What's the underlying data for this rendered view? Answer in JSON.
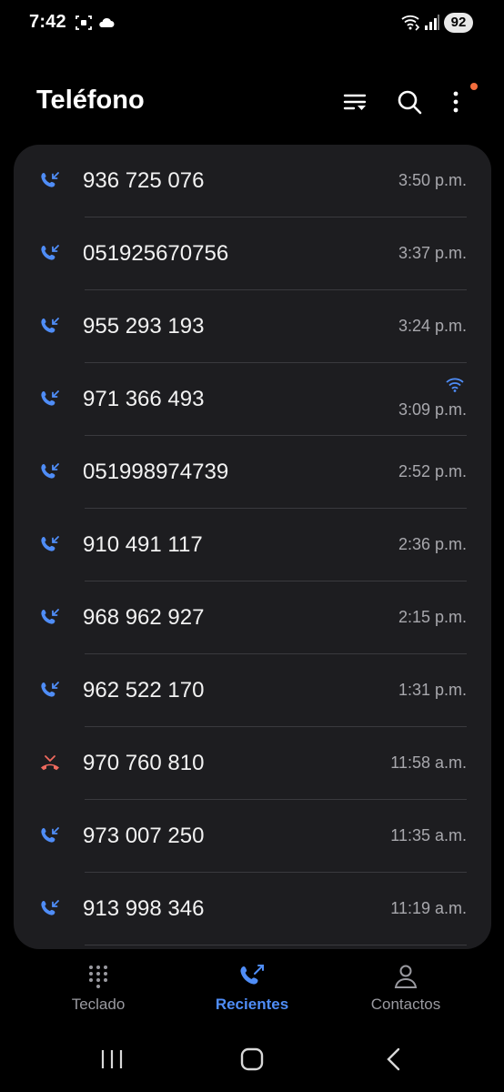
{
  "status_bar": {
    "time": "7:42",
    "battery": "92",
    "icons": [
      "screenshot-icon",
      "cloud-icon",
      "wifi-calling-icon",
      "signal-icon"
    ]
  },
  "header": {
    "title": "Teléfono",
    "icons": [
      "filter-icon",
      "search-icon",
      "more-options-icon"
    ],
    "notification_dot_color": "#f26d3d"
  },
  "colors": {
    "accent": "#4f8df7",
    "missed": "#f06a5e",
    "card_bg": "#1d1d20",
    "time_text": "#a8a8ad"
  },
  "calls": [
    {
      "number": "936 725 076",
      "time": "3:50 p.m.",
      "type": "incoming",
      "wifi_call": false
    },
    {
      "number": "051925670756",
      "time": "3:37 p.m.",
      "type": "incoming",
      "wifi_call": false
    },
    {
      "number": "955 293 193",
      "time": "3:24 p.m.",
      "type": "incoming",
      "wifi_call": false
    },
    {
      "number": "971 366 493",
      "time": "3:09 p.m.",
      "type": "incoming",
      "wifi_call": true
    },
    {
      "number": "051998974739",
      "time": "2:52 p.m.",
      "type": "incoming",
      "wifi_call": false
    },
    {
      "number": "910 491 117",
      "time": "2:36 p.m.",
      "type": "incoming",
      "wifi_call": false
    },
    {
      "number": "968 962 927",
      "time": "2:15 p.m.",
      "type": "incoming",
      "wifi_call": false
    },
    {
      "number": "962 522 170",
      "time": "1:31 p.m.",
      "type": "incoming",
      "wifi_call": false
    },
    {
      "number": "970 760 810",
      "time": "11:58 a.m.",
      "type": "missed",
      "wifi_call": false
    },
    {
      "number": "973 007 250",
      "time": "11:35 a.m.",
      "type": "incoming",
      "wifi_call": false
    },
    {
      "number": "913 998 346",
      "time": "11:19 a.m.",
      "type": "incoming",
      "wifi_call": false
    }
  ],
  "bottom_nav": {
    "tabs": [
      {
        "label": "Teclado",
        "icon": "keypad-icon",
        "active": false
      },
      {
        "label": "Recientes",
        "icon": "recent-calls-icon",
        "active": true
      },
      {
        "label": "Contactos",
        "icon": "contacts-icon",
        "active": false
      }
    ]
  },
  "system_nav": [
    "recents-button",
    "home-button",
    "back-button"
  ]
}
